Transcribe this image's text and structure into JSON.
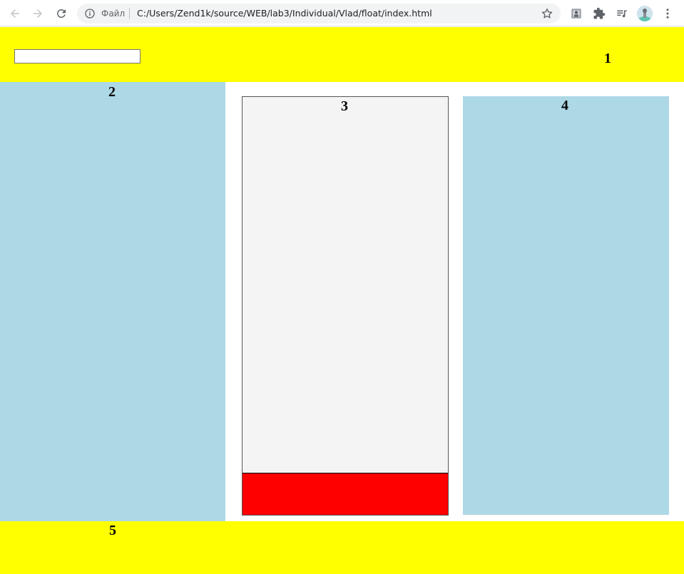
{
  "browser": {
    "file_label": "Файл",
    "url": "C:/Users/Zend1k/source/WEB/lab3/Individual/Vlad/float/index.html",
    "icons": [
      "back-icon",
      "forward-icon",
      "reload-icon",
      "info-icon",
      "star-icon",
      "extension-icon",
      "puzzle-icon",
      "media-icon",
      "avatar",
      "menu-icon"
    ]
  },
  "page": {
    "header": {
      "label": "1",
      "input_value": ""
    },
    "left": {
      "label": "2"
    },
    "center": {
      "label": "3"
    },
    "right": {
      "label": "4"
    },
    "footer": {
      "label": "5"
    }
  },
  "colors": {
    "yellow": "#ffff00",
    "lightblue": "#add8e6",
    "red": "#ff0000",
    "gray": "#f4f4f4"
  }
}
